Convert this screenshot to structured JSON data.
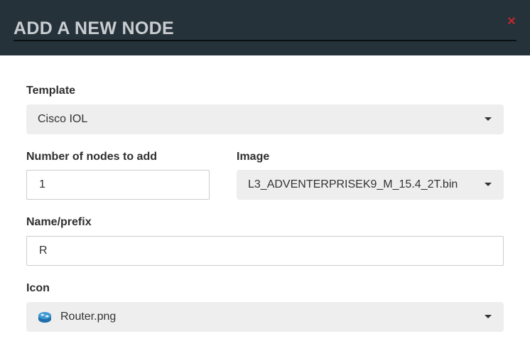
{
  "dialog": {
    "title": "ADD A NEW NODE",
    "close_glyph": "×"
  },
  "fields": {
    "template": {
      "label": "Template",
      "value": "Cisco IOL"
    },
    "nodes_to_add": {
      "label": "Number of nodes to add",
      "value": "1"
    },
    "image": {
      "label": "Image",
      "value": "L3_ADVENTERPRISEK9_M_15.4_2T.bin"
    },
    "name_prefix": {
      "label": "Name/prefix",
      "value": "R"
    },
    "icon": {
      "label": "Icon",
      "value": "Router.png",
      "icon_name": "router-icon"
    }
  },
  "colors": {
    "header_bg": "#26323a",
    "title": "#c9cdd1",
    "close": "#c0272d",
    "select_bg": "#eeeeee"
  }
}
